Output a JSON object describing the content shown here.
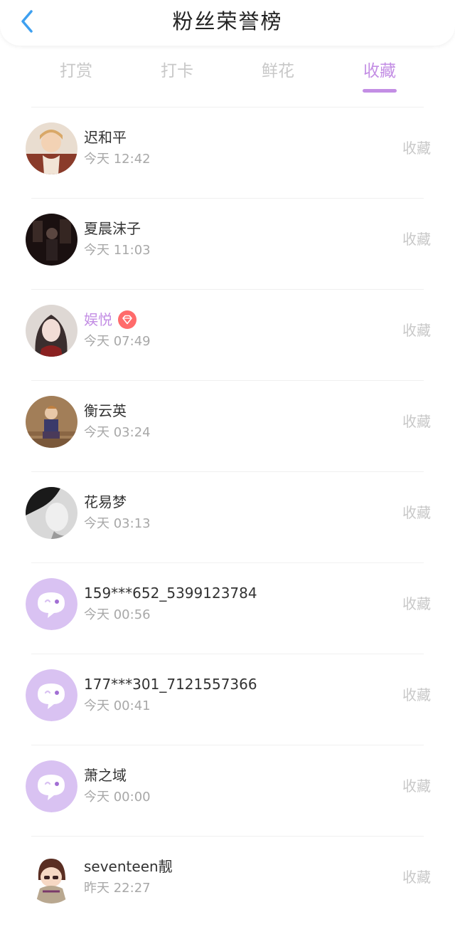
{
  "header": {
    "title": "粉丝荣誉榜"
  },
  "tabs": [
    {
      "label": "打赏"
    },
    {
      "label": "打卡"
    },
    {
      "label": "鲜花"
    },
    {
      "label": "收藏"
    }
  ],
  "active_tab": "收藏",
  "accent_color": "#c38ee4",
  "fans": [
    {
      "name": "迟和平",
      "time": "今天 12:42",
      "action": "收藏",
      "avatar": "photo-warm"
    },
    {
      "name": "夏晨沫子",
      "time": "今天 11:03",
      "action": "收藏",
      "avatar": "photo-dark"
    },
    {
      "name": "娱悦",
      "time": "今天 07:49",
      "action": "收藏",
      "avatar": "photo-girl",
      "vip": true
    },
    {
      "name": "衡云英",
      "time": "今天 03:24",
      "action": "收藏",
      "avatar": "photo-stairs"
    },
    {
      "name": "花易梦",
      "time": "今天 03:13",
      "action": "收藏",
      "avatar": "photo-bw"
    },
    {
      "name": "159***652_5399123784",
      "time": "今天 00:56",
      "action": "收藏",
      "avatar": "default-chat-icon"
    },
    {
      "name": "177***301_7121557366",
      "time": "今天 00:41",
      "action": "收藏",
      "avatar": "default-chat-icon"
    },
    {
      "name": "萧之域",
      "time": "今天 00:00",
      "action": "收藏",
      "avatar": "default-chat-icon"
    },
    {
      "name": "seventeen靓",
      "time": "昨天 22:27",
      "action": "收藏",
      "avatar": "cartoon-girl"
    }
  ]
}
